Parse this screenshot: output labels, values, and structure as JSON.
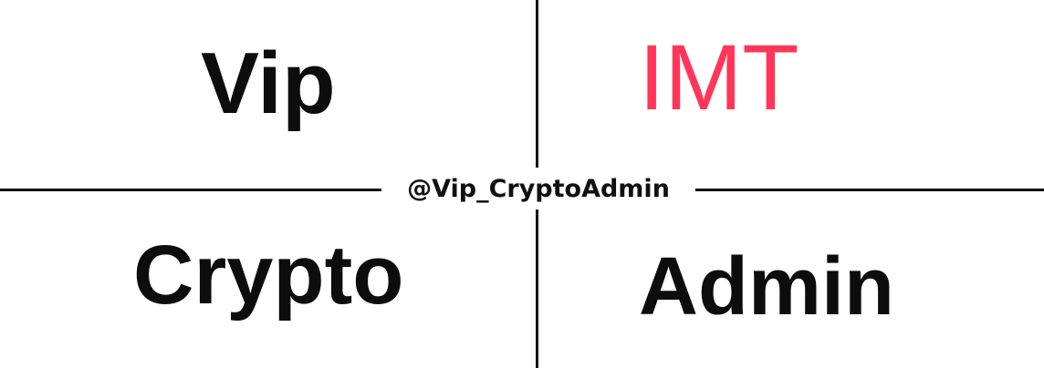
{
  "quadrants": {
    "top_left": "Vip",
    "top_right": "IMT",
    "bottom_left": "Crypto",
    "bottom_right": "Admin"
  },
  "center_label": "@Vip_CryptoAdmin",
  "colors": {
    "background": "#ffffff",
    "text_primary": "#0d0d0d",
    "accent": "#ff3659",
    "lines": "#111111"
  }
}
